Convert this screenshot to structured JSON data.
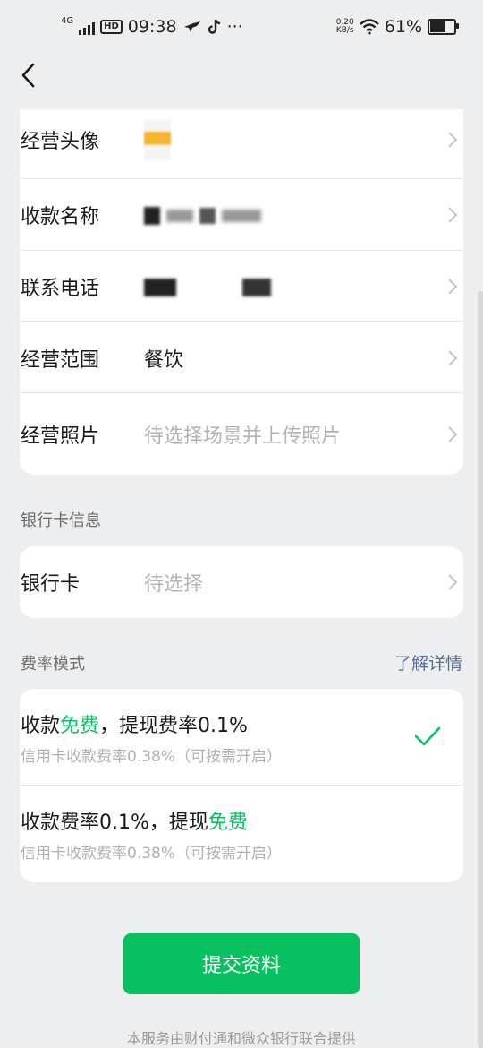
{
  "status_bar": {
    "network": "4G",
    "hd": "HD",
    "time": "09:38",
    "more": "···",
    "net_speed_value": "0.20",
    "net_speed_unit": "KB/s",
    "battery": "61%",
    "battery_level": 0.61
  },
  "rows": [
    {
      "label": "经营头像",
      "value": "",
      "placeholder": false
    },
    {
      "label": "收款名称",
      "value": "",
      "placeholder": false
    },
    {
      "label": "联系电话",
      "value": "",
      "placeholder": false
    },
    {
      "label": "经营范围",
      "value": "餐饮",
      "placeholder": false
    },
    {
      "label": "经营照片",
      "value": "待选择场景并上传照片",
      "placeholder": true
    }
  ],
  "bank_section": {
    "title": "银行卡信息",
    "row_label": "银行卡",
    "row_value": "待选择"
  },
  "fee_section": {
    "title": "费率模式",
    "link": "了解详情",
    "options": [
      {
        "main_a": "收款",
        "main_green": "免费",
        "main_b": "，提现费率0.1%",
        "sub": "信用卡收款费率0.38%（可按需开启）",
        "selected": true
      },
      {
        "main_a": "收款费率0.1%，提现",
        "main_green": "免费",
        "main_b": "",
        "sub": "信用卡收款费率0.38%（可按需开启）",
        "selected": false
      }
    ]
  },
  "submit_label": "提交资料",
  "footer": "本服务由财付通和微众银行联合提供",
  "colors": {
    "accent": "#07C160",
    "link": "#576B95"
  }
}
